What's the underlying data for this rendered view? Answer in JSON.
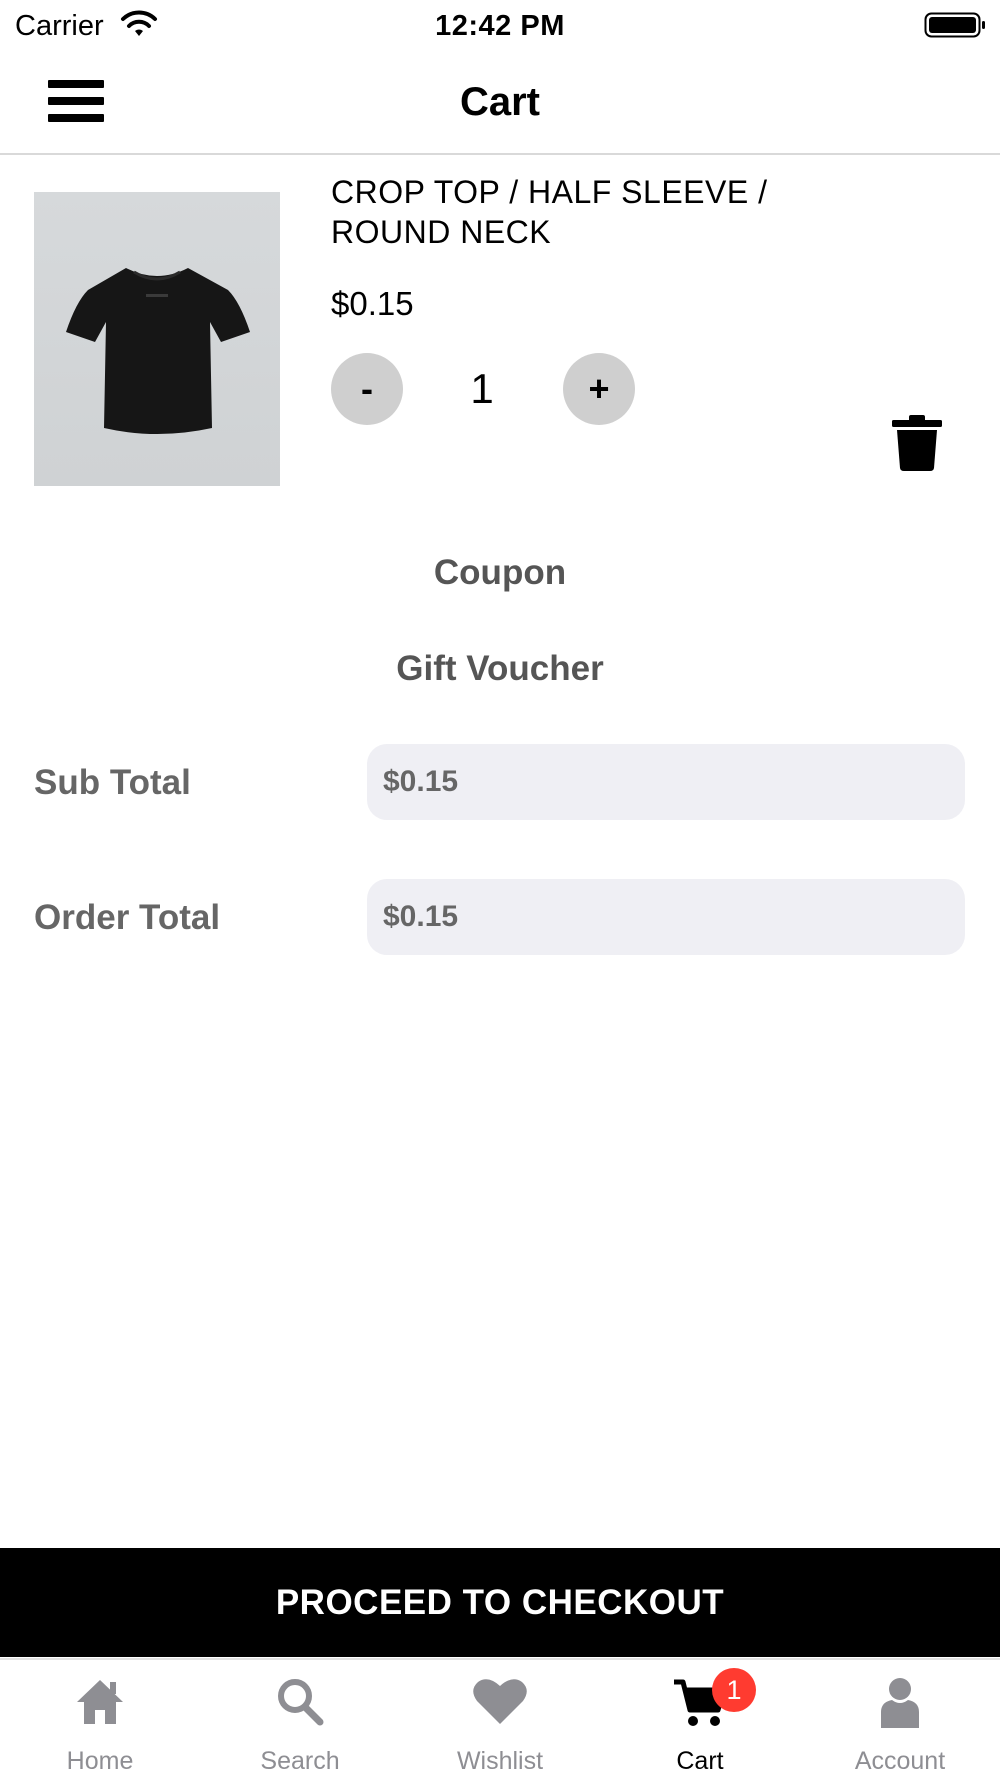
{
  "status_bar": {
    "carrier": "Carrier",
    "time": "12:42 PM"
  },
  "nav": {
    "title": "Cart"
  },
  "cart_item": {
    "name": "CROP TOP / HALF SLEEVE / ROUND NECK",
    "price": "$0.15",
    "quantity": "1",
    "decrement_label": "-",
    "increment_label": "+"
  },
  "links": {
    "coupon": "Coupon",
    "gift_voucher": "Gift Voucher"
  },
  "totals": {
    "sub_total_label": "Sub Total",
    "sub_total_value": "$0.15",
    "order_total_label": "Order Total",
    "order_total_value": "$0.15"
  },
  "checkout": {
    "label": "PROCEED TO CHECKOUT"
  },
  "tabs": [
    {
      "label": "Home",
      "icon": "home-icon"
    },
    {
      "label": "Search",
      "icon": "search-icon"
    },
    {
      "label": "Wishlist",
      "icon": "heart-icon"
    },
    {
      "label": "Cart",
      "icon": "cart-icon",
      "badge": "1",
      "active": true
    },
    {
      "label": "Account",
      "icon": "account-icon"
    }
  ],
  "colors": {
    "inactive_tab": "#8e8e93",
    "badge": "#ff3b30",
    "field_background": "#efeff4",
    "checkout_background": "#000000"
  }
}
